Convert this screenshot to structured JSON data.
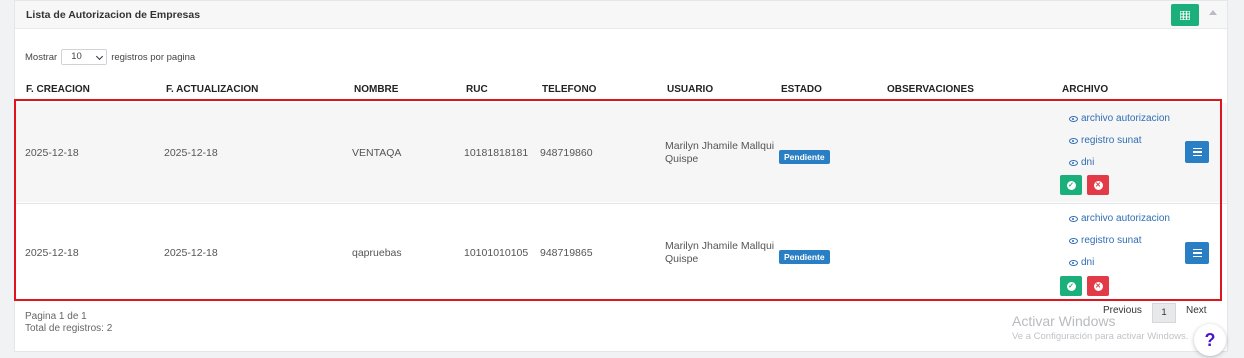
{
  "panel": {
    "title": "Lista de Autorizacion de Empresas",
    "grid_icon": "grid-icon",
    "collapse_icon": "chevron-up-icon"
  },
  "length": {
    "prefix": "Mostrar",
    "value": "10",
    "suffix": "registros por pagina"
  },
  "columns": [
    "F. CREACION",
    "F. ACTUALIZACION",
    "NOMBRE",
    "RUC",
    "TELEFONO",
    "USUARIO",
    "ESTADO",
    "OBSERVACIONES",
    "ARCHIVO"
  ],
  "rows": [
    {
      "creacion": "2025-12-18",
      "actualizacion": "2025-12-18",
      "nombre": "VENTAQA",
      "ruc": "10181818181",
      "telefono": "948719860",
      "usuario": "Marilyn Jhamile Mallqui Quispe",
      "estado": "Pendiente",
      "observaciones": "",
      "archivos": [
        "archivo autorizacion",
        "registro sunat",
        "dni"
      ]
    },
    {
      "creacion": "2025-12-18",
      "actualizacion": "2025-12-18",
      "nombre": "qapruebas",
      "ruc": "10101010105",
      "telefono": "948719865",
      "usuario": "Marilyn Jhamile Mallqui Quispe",
      "estado": "Pendiente",
      "observaciones": "",
      "archivos": [
        "archivo autorizacion",
        "registro sunat",
        "dni"
      ]
    }
  ],
  "footer": {
    "page_info": "Pagina 1 de 1",
    "total": "Total de registros: 2"
  },
  "pagination": {
    "previous": "Previous",
    "current": "1",
    "next": "Next"
  },
  "watermark": {
    "line1": "Activar Windows",
    "line2": "Ve a Configuración para activar Windows."
  },
  "help": {
    "label": "?"
  },
  "colors": {
    "success": "#1aaf7b",
    "danger": "#e23a46",
    "primary": "#2a7fc4",
    "highlight": "#e0141e"
  }
}
